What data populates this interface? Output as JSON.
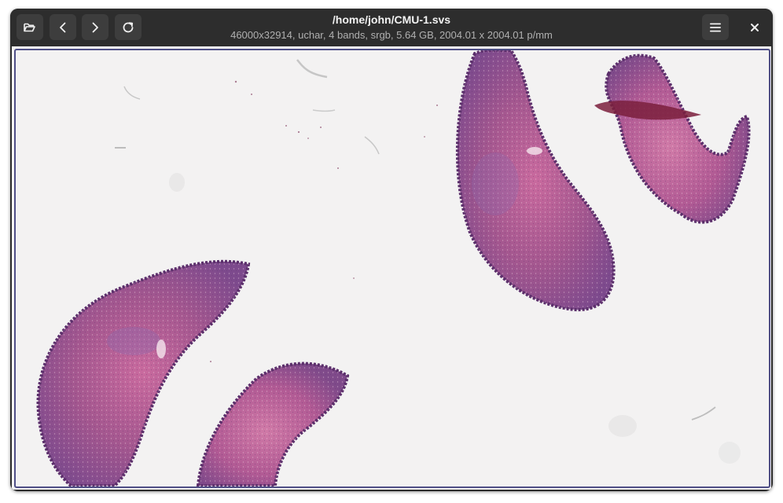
{
  "window": {
    "title": "/home/john/CMU-1.svs",
    "subtitle": "46000x32914,  uchar, 4 bands, srgb, 5.64 GB, 2004.01 x 2004.01 p/mm"
  },
  "toolbar": {
    "left_buttons": [
      {
        "name": "open-button",
        "icon": "folder-open-icon"
      },
      {
        "name": "back-button",
        "icon": "chevron-left-icon"
      },
      {
        "name": "forward-button",
        "icon": "chevron-right-icon"
      },
      {
        "name": "reload-button",
        "icon": "reload-icon"
      }
    ],
    "menu_icon": "hamburger-menu-icon",
    "close_icon": "close-icon"
  },
  "viewer": {
    "content": "whole-slide image of H&E stained tissue sections",
    "colors": {
      "tissue_pink": "#c85f92",
      "tissue_purple": "#7a4a8c",
      "tissue_edge": "#5b2f6b",
      "background": "#f3f2f2",
      "frame_border": "#4f4f86"
    }
  }
}
